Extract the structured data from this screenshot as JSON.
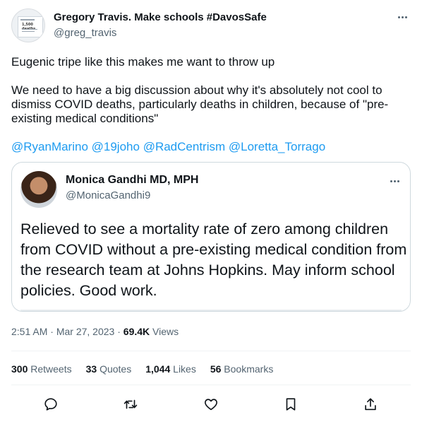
{
  "tweet": {
    "author_name": "Gregory Travis. Make schools #DavosSafe",
    "author_handle": "@greg_travis",
    "text_line1": "Eugenic tripe like this makes me want to throw up",
    "text_para2": "We need to have a big discussion about why it's absolutely not cool to dismiss COVID deaths, particularly deaths in children, because of \"pre-existing medical conditions\"",
    "mentions": [
      "@RyanMarino",
      "@19joho",
      "@RadCentrism",
      "@Loretta_Torrago"
    ],
    "time": "2:51 AM",
    "separator": " · ",
    "date": "Mar 27, 2023",
    "views_count": "69.4K",
    "views_label": " Views"
  },
  "avatar_text": "1,500 deaths",
  "quoted": {
    "author_name": "Monica Gandhi MD, MPH",
    "author_handle": "@MonicaGandhi9",
    "text": "Relieved to see a mortality rate of zero among children from COVID without a pre-existing medical condition from the research team at Johns Hopkins. May inform school policies. Good work."
  },
  "stats": [
    {
      "count": "300",
      "label": " Retweets"
    },
    {
      "count": "33",
      "label": " Quotes"
    },
    {
      "count": "1,044",
      "label": " Likes"
    },
    {
      "count": "56",
      "label": " Bookmarks"
    }
  ],
  "colors": {
    "link": "#1d9bf0",
    "text": "#0f1419",
    "secondary": "#536471",
    "border": "#cfd9de"
  },
  "actions": [
    "reply-icon",
    "retweet-icon",
    "like-icon",
    "bookmark-icon",
    "share-icon"
  ]
}
